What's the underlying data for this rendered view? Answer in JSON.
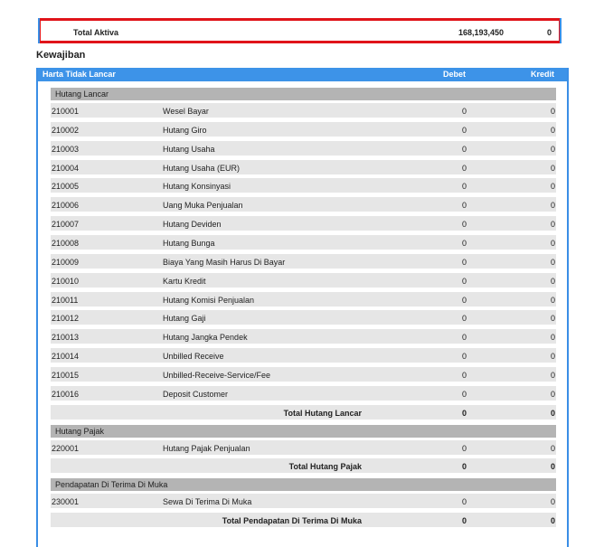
{
  "total_aktiva": {
    "label": "Total Aktiva",
    "debet": "168,193,450",
    "kredit": "0"
  },
  "kewajiban": {
    "title": "Kewajiban",
    "header": {
      "name": "Harta Tidak Lancar",
      "debet": "Debet",
      "kredit": "Kredit"
    },
    "groups": [
      {
        "label": "Hutang Lancar",
        "rows": [
          {
            "code": "210001",
            "name": "Wesel Bayar",
            "debet": "0",
            "kredit": "0"
          },
          {
            "code": "210002",
            "name": "Hutang Giro",
            "debet": "0",
            "kredit": "0"
          },
          {
            "code": "210003",
            "name": "Hutang Usaha",
            "debet": "0",
            "kredit": "0"
          },
          {
            "code": "210004",
            "name": "Hutang Usaha (EUR)",
            "debet": "0",
            "kredit": "0"
          },
          {
            "code": "210005",
            "name": "Hutang Konsinyasi",
            "debet": "0",
            "kredit": "0"
          },
          {
            "code": "210006",
            "name": "Uang Muka Penjualan",
            "debet": "0",
            "kredit": "0"
          },
          {
            "code": "210007",
            "name": "Hutang Deviden",
            "debet": "0",
            "kredit": "0"
          },
          {
            "code": "210008",
            "name": "Hutang Bunga",
            "debet": "0",
            "kredit": "0"
          },
          {
            "code": "210009",
            "name": "Biaya Yang Masih Harus Di Bayar",
            "debet": "0",
            "kredit": "0"
          },
          {
            "code": "210010",
            "name": "Kartu Kredit",
            "debet": "0",
            "kredit": "0"
          },
          {
            "code": "210011",
            "name": "Hutang Komisi Penjualan",
            "debet": "0",
            "kredit": "0"
          },
          {
            "code": "210012",
            "name": "Hutang Gaji",
            "debet": "0",
            "kredit": "0"
          },
          {
            "code": "210013",
            "name": "Hutang Jangka Pendek",
            "debet": "0",
            "kredit": "0"
          },
          {
            "code": "210014",
            "name": "Unbilled Receive",
            "debet": "0",
            "kredit": "0"
          },
          {
            "code": "210015",
            "name": "Unbilled-Receive-Service/Fee",
            "debet": "0",
            "kredit": "0"
          },
          {
            "code": "210016",
            "name": "Deposit Customer",
            "debet": "0",
            "kredit": "0"
          }
        ],
        "total": {
          "label": "Total Hutang Lancar",
          "debet": "0",
          "kredit": "0"
        }
      },
      {
        "label": "Hutang Pajak",
        "rows": [
          {
            "code": "220001",
            "name": "Hutang Pajak Penjualan",
            "debet": "0",
            "kredit": "0"
          }
        ],
        "total": {
          "label": "Total Hutang Pajak",
          "debet": "0",
          "kredit": "0"
        }
      },
      {
        "label": "Pendapatan Di Terima Di Muka",
        "rows": [
          {
            "code": "230001",
            "name": "Sewa Di Terima Di Muka",
            "debet": "0",
            "kredit": "0"
          }
        ],
        "total": {
          "label": "Total Pendapatan Di Terima Di Muka",
          "debet": "0",
          "kredit": "0"
        }
      }
    ]
  }
}
